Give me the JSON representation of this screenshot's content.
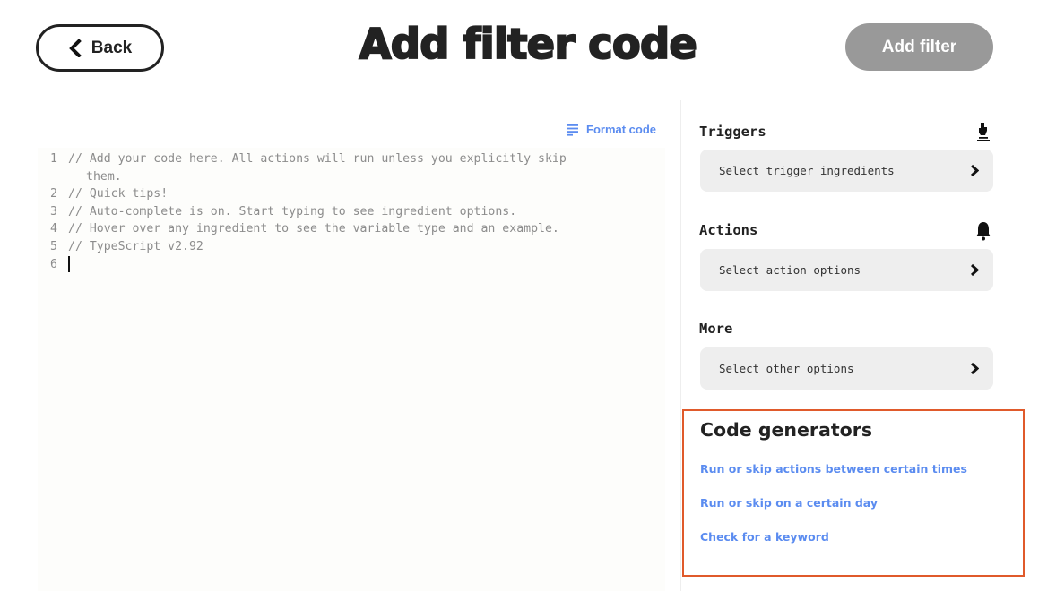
{
  "header": {
    "back_label": "Back",
    "title": "Add filter code",
    "add_filter_label": "Add filter"
  },
  "editor": {
    "format_code_label": "Format code",
    "lines": [
      {
        "num": "1",
        "text": "// Add your code here. All actions will run unless you explicitly skip",
        "continuation": "them."
      },
      {
        "num": "2",
        "text": "// Quick tips!"
      },
      {
        "num": "3",
        "text": "// Auto-complete is on. Start typing to see ingredient options."
      },
      {
        "num": "4",
        "text": "// Hover over any ingredient to see the variable type and an example."
      },
      {
        "num": "5",
        "text": "// TypeScript v2.92"
      },
      {
        "num": "6",
        "text": ""
      }
    ]
  },
  "sidebar": {
    "sections": [
      {
        "title": "Triggers",
        "icon": "hand-pointer-icon",
        "select_label": "Select trigger ingredients"
      },
      {
        "title": "Actions",
        "icon": "bell-icon",
        "select_label": "Select action options"
      },
      {
        "title": "More",
        "select_label": "Select other options"
      }
    ],
    "code_generators": {
      "title": "Code generators",
      "links": [
        "Run or skip actions between certain times",
        "Run or skip on a certain day",
        "Check for a keyword"
      ]
    }
  },
  "colors": {
    "link": "#5b8cf0",
    "highlight_border": "#e05a2b",
    "disabled_button": "#999999"
  }
}
